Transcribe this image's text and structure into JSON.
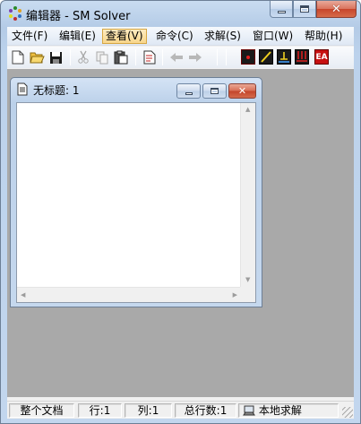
{
  "window": {
    "title": "编辑器 - SM Solver",
    "app_icon": "sm-solver-app-icon"
  },
  "menu": {
    "items": [
      {
        "label": "文件(F)"
      },
      {
        "label": "编辑(E)"
      },
      {
        "label": "查看(V)",
        "active": true
      },
      {
        "label": "命令(C)"
      },
      {
        "label": "求解(S)"
      },
      {
        "label": "窗口(W)"
      },
      {
        "label": "帮助(H)"
      }
    ]
  },
  "toolbar": {
    "icons": [
      "new-file-icon",
      "open-folder-icon",
      "save-icon",
      "cut-icon",
      "copy-icon",
      "paste-icon",
      "print-preview-icon",
      "back-arrow-icon",
      "forward-arrow-icon",
      "point-icon",
      "line-icon",
      "constraint-icon",
      "load-icon",
      "ea-icon"
    ],
    "ea_label": "EA"
  },
  "child_window": {
    "title": "无标题: 1",
    "editor_content": ""
  },
  "statusbar": {
    "scope": "整个文档",
    "row": "行:1",
    "col": "列:1",
    "total_rows": "总行数:1",
    "solve_mode": "本地求解"
  },
  "colors": {
    "mdi_background": "#a9a9a9",
    "toolbar_red": "#c71010",
    "menu_active": "#f8d68b"
  }
}
